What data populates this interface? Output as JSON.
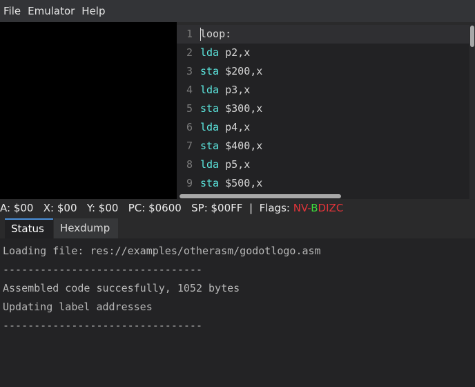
{
  "menu": {
    "items": [
      "File",
      "Emulator",
      "Help"
    ]
  },
  "editor": {
    "lines": [
      {
        "num": "1",
        "op": "",
        "text": "loop:"
      },
      {
        "num": "2",
        "op": "lda",
        "text": " p2,x"
      },
      {
        "num": "3",
        "op": "sta",
        "text": " $200,x"
      },
      {
        "num": "4",
        "op": "lda",
        "text": " p3,x"
      },
      {
        "num": "5",
        "op": "sta",
        "text": " $300,x"
      },
      {
        "num": "6",
        "op": "lda",
        "text": " p4,x"
      },
      {
        "num": "7",
        "op": "sta",
        "text": " $400,x"
      },
      {
        "num": "8",
        "op": "lda",
        "text": " p5,x"
      },
      {
        "num": "9",
        "op": "sta",
        "text": " $500,x"
      }
    ],
    "keyword_color": "#5ce8e0"
  },
  "registers": {
    "a": "A: $00",
    "x": "X: $00",
    "y": "Y: $00",
    "pc": "PC: $0600",
    "sp": "SP: $00FF",
    "separator": "|",
    "flags_label": "Flags:",
    "flag_n": "N",
    "flag_v": "V",
    "flag_dash": "-",
    "flag_b": "B",
    "flag_d": "D",
    "flag_i": "I",
    "flag_z": "Z",
    "flag_c": "C",
    "flag_set_color": "#3ddc3d",
    "flag_clear_color": "#e3343a"
  },
  "tabs": {
    "status": "Status",
    "hexdump": "Hexdump"
  },
  "console": {
    "lines": [
      "Loading file: res://examples/otherasm/godotlogo.asm",
      "--------------------------------",
      "Assembled code succesfully, 1052 bytes",
      "Updating label addresses",
      "--------------------------------"
    ]
  }
}
